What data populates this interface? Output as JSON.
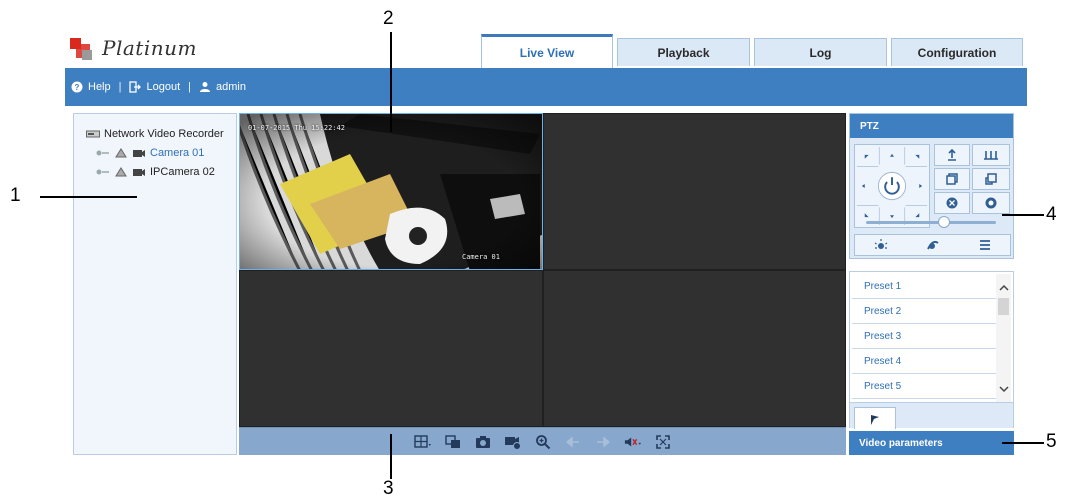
{
  "brand": {
    "name": "Platinum"
  },
  "tabs": [
    {
      "label": "Live View",
      "active": true
    },
    {
      "label": "Playback",
      "active": false
    },
    {
      "label": "Log",
      "active": false
    },
    {
      "label": "Configuration",
      "active": false
    }
  ],
  "header": {
    "help_label": "Help",
    "logout_label": "Logout",
    "user_label": "admin",
    "separator": "|"
  },
  "tree": {
    "root_label": "Network Video Recorder",
    "cameras": [
      {
        "label": "Camera 01",
        "selected": true
      },
      {
        "label": "IPCamera 02",
        "selected": false
      }
    ]
  },
  "video": {
    "osd_datetime": "01-07-2015 Thu 15:22:42",
    "osd_camera": "Camera 01"
  },
  "toolbar": {
    "icons": [
      "layout-icon",
      "window-switch-icon",
      "capture-icon",
      "record-icon",
      "zoom-icon",
      "prev-page-icon",
      "next-page-icon",
      "audio-icon",
      "fullscreen-icon"
    ]
  },
  "ptz": {
    "title": "PTZ",
    "speed_level": 0.6
  },
  "presets": {
    "items": [
      "Preset 1",
      "Preset 2",
      "Preset 3",
      "Preset 4",
      "Preset 5"
    ]
  },
  "video_parameters": {
    "label": "Video parameters"
  },
  "callouts": [
    "1",
    "2",
    "3",
    "4",
    "5"
  ],
  "colors": {
    "accent": "#3e7fc1",
    "toolbar": "#87a8cc",
    "panel": "#dde9f6",
    "link": "#2f6fb6"
  }
}
